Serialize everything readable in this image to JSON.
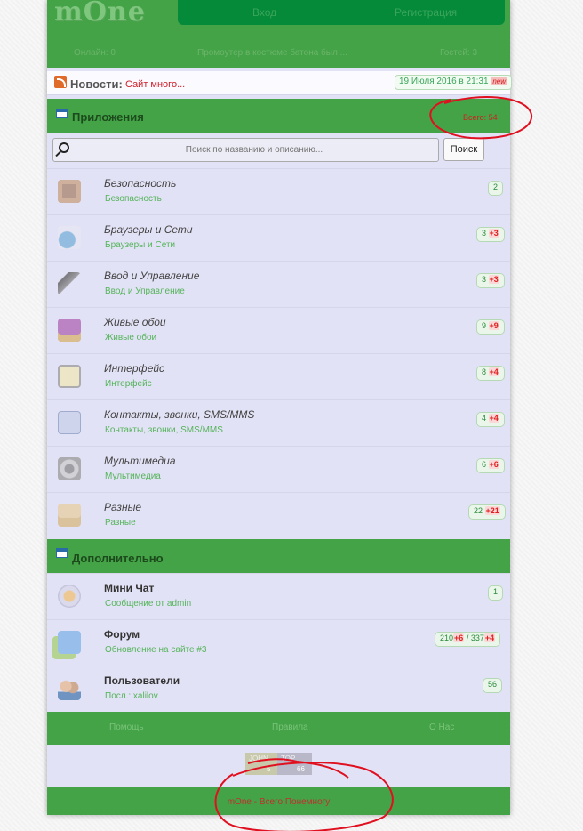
{
  "colors": {
    "header_green": "#43a346",
    "auth_green": "#058a3a",
    "panel": "#e2e2f6",
    "link_green": "#55b45a",
    "alert_red": "#d02020"
  },
  "header": {
    "logo": "mOne",
    "login": "Вход",
    "register": "Регистрация",
    "online": "Онлайн: 0",
    "promo": "Промоутер в костюме батона был ...",
    "guests": "Гостей: 3"
  },
  "news": {
    "label": "Новости:",
    "text": "Сайт много...",
    "date": "19 Июля 2016 в 21:31",
    "new_badge": "new"
  },
  "apps": {
    "title": "Приложения",
    "total": "Всего: 54",
    "search_placeholder": "Поиск по названию и описанию...",
    "search_button": "Поиск",
    "items": [
      {
        "title": "Безопасность",
        "sub": "Безопасность",
        "count": "2",
        "plus": "",
        "icon": "security-icon"
      },
      {
        "title": "Браузеры и Сети",
        "sub": "Браузеры и Сети",
        "count": "3",
        "plus": "+3",
        "icon": "browsers-icon"
      },
      {
        "title": "Ввод и Управление",
        "sub": "Ввод и Управление",
        "count": "3",
        "plus": "+3",
        "icon": "input-icon"
      },
      {
        "title": "Живые обои",
        "sub": "Живые обои",
        "count": "9",
        "plus": "+9",
        "icon": "wallpapers-icon"
      },
      {
        "title": "Интерфейс",
        "sub": "Интерфейс",
        "count": "8",
        "plus": "+4",
        "icon": "interface-icon"
      },
      {
        "title": "Контакты, звонки, SMS/MMS",
        "sub": "Контакты, звонки, SMS/MMS",
        "count": "4",
        "plus": "+4",
        "icon": "contacts-icon"
      },
      {
        "title": "Мультимедиа",
        "sub": "Мультимедиа",
        "count": "6",
        "plus": "+6",
        "icon": "multimedia-icon"
      },
      {
        "title": "Разные",
        "sub": "Разные",
        "count": "22",
        "plus": "+21",
        "icon": "misc-icon"
      }
    ]
  },
  "extra": {
    "title": "Дополнительно",
    "chat": {
      "title": "Мини Чат",
      "sub": "Сообщение от admin",
      "count": "1"
    },
    "forum": {
      "title": "Форум",
      "sub": "Обновление на сайте #3",
      "count1": "210",
      "plus1": "+6",
      "sep": "/",
      "count2": "337",
      "plus2": "+4"
    },
    "users": {
      "title": "Пользователи",
      "sub": "Посл.: xalilov",
      "count": "56"
    }
  },
  "footer": {
    "help": "Помощь",
    "rules": "Правила",
    "about": "О Нас",
    "counter_label1": "JOHN",
    "counter_label2": "TOP",
    "counter_value1": "5",
    "counter_value2": "66",
    "tagline": "mOne - Всего Понемногу"
  }
}
